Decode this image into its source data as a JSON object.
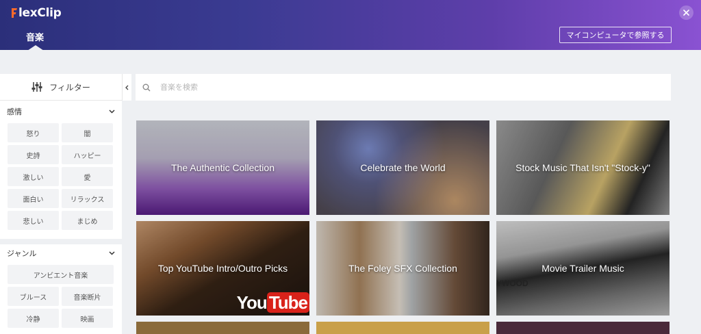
{
  "app": {
    "logo_text": "lexClip",
    "logo_letter": "F"
  },
  "header": {
    "active_tab": "音楽",
    "browse_button": "マイコンピュータで参照する"
  },
  "sidebar": {
    "filter_label": "フィルター",
    "sections": [
      {
        "title": "感情",
        "chips": [
          "怒り",
          "闇",
          "史詩",
          "ハッピー",
          "激しい",
          "愛",
          "面白い",
          "リラックス",
          "悲しい",
          "まじめ"
        ]
      },
      {
        "title": "ジャンル",
        "chips": [
          "アンビエント音楽",
          "ブルース",
          "音楽断片",
          "冷静",
          "映画"
        ]
      }
    ]
  },
  "search": {
    "placeholder": "音楽を検索"
  },
  "cards": [
    {
      "title": "The Authentic Collection"
    },
    {
      "title": "Celebrate the World"
    },
    {
      "title": "Stock Music That Isn't \"Stock-y\""
    },
    {
      "title": "Top YouTube Intro/Outro Picks",
      "watermark": "YouTube"
    },
    {
      "title": "The Foley SFX Collection"
    },
    {
      "title": "Movie Trailer Music",
      "watermark": "YWOOD"
    }
  ]
}
